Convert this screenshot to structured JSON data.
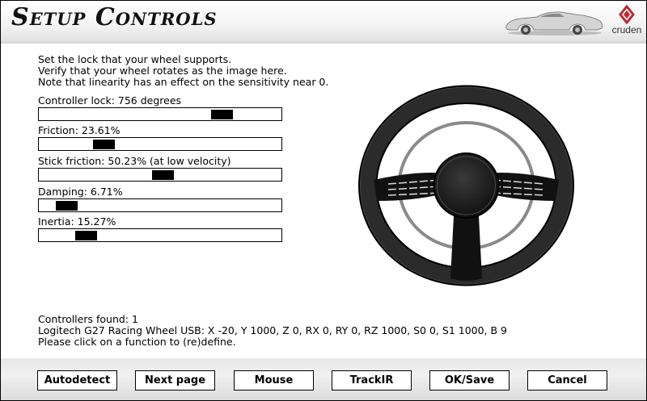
{
  "header": {
    "title": "Setup Controls",
    "brand": "cruden",
    "car_icon": "convertible-car-icon",
    "logo_icon": "cruden-logo-icon"
  },
  "instructions": {
    "line1": "Set the lock that your wheel supports.",
    "line2": "Verify that your wheel rotates as the image here.",
    "line3": "Note that linearity has an effect on the sensitivity near 0."
  },
  "sliders": [
    {
      "label": "Controller lock: 756 degrees",
      "value": 0.77
    },
    {
      "label": "Friction: 23.61%",
      "value": 0.2361
    },
    {
      "label": "Stick friction: 50.23% (at low velocity)",
      "value": 0.5023
    },
    {
      "label": "Damping: 6.71%",
      "value": 0.0671
    },
    {
      "label": "Inertia: 15.27%",
      "value": 0.1527
    }
  ],
  "wheel": {
    "icon": "steering-wheel-icon"
  },
  "status": {
    "controllers_found": "Controllers found: 1",
    "device": "Logitech G27 Racing Wheel USB: X -20, Y 1000, Z 0, RX 0, RY 0, RZ 1000, S0 0, S1 1000, B 9",
    "hint": "Please click on a function to (re)define."
  },
  "buttons": {
    "autodetect": "Autodetect",
    "next_page": "Next page",
    "mouse": "Mouse",
    "trackir": "TrackIR",
    "ok_save": "OK/Save",
    "cancel": "Cancel"
  }
}
